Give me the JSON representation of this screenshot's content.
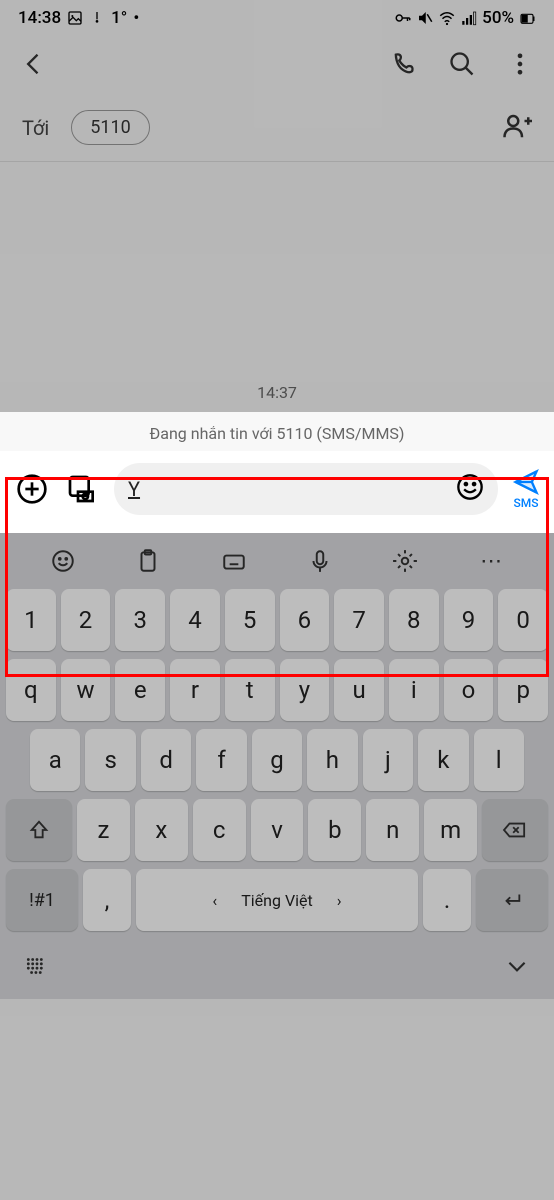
{
  "status": {
    "time": "14:38",
    "temp": "1°",
    "battery": "50%"
  },
  "recipient": {
    "to_label": "Tới",
    "number": "5110"
  },
  "messages": {
    "timestamp": "14:37"
  },
  "compose": {
    "header": "Đang nhắn tin với 5110 (SMS/MMS)",
    "input_value": "Y",
    "send_label": "SMS"
  },
  "keyboard": {
    "row1": [
      "1",
      "2",
      "3",
      "4",
      "5",
      "6",
      "7",
      "8",
      "9",
      "0"
    ],
    "row2": [
      "q",
      "w",
      "e",
      "r",
      "t",
      "y",
      "u",
      "i",
      "o",
      "p"
    ],
    "row3": [
      "a",
      "s",
      "d",
      "f",
      "g",
      "h",
      "j",
      "k",
      "l"
    ],
    "row4": [
      "z",
      "x",
      "c",
      "v",
      "b",
      "n",
      "m"
    ],
    "sym_key": "!#1",
    "comma_key": ",",
    "space_key": "Tiếng Việt",
    "dot_key": "."
  }
}
